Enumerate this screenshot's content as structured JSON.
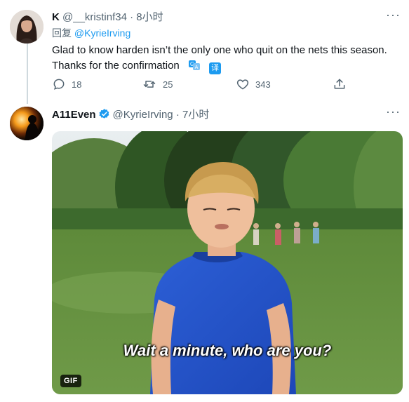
{
  "tweets": [
    {
      "name": "K",
      "handle": "@__kristinf34",
      "separator": "·",
      "time": "8小时",
      "reply_prefix": "回复",
      "reply_mention": "@KyrieIrving",
      "text": "Glad to know harden isn’t the only one who quit on the nets this season. Thanks for the confirmation",
      "translate_label": "译",
      "stats": {
        "replies": "18",
        "retweets": "25",
        "likes": "343"
      }
    },
    {
      "name": "A11Even",
      "handle": "@KyrieIrving",
      "separator": "·",
      "time": "7小时",
      "verified": true,
      "media": {
        "caption": "Wait a minute, who are you?",
        "badge": "GIF"
      }
    }
  ],
  "colors": {
    "accent": "#1d9bf0",
    "secondary_text": "#536471",
    "primary_text": "#0f1419"
  },
  "icons": [
    "more-icon",
    "reply-icon",
    "retweet-icon",
    "like-icon",
    "share-icon",
    "translate-icon",
    "verified-badge-icon"
  ]
}
